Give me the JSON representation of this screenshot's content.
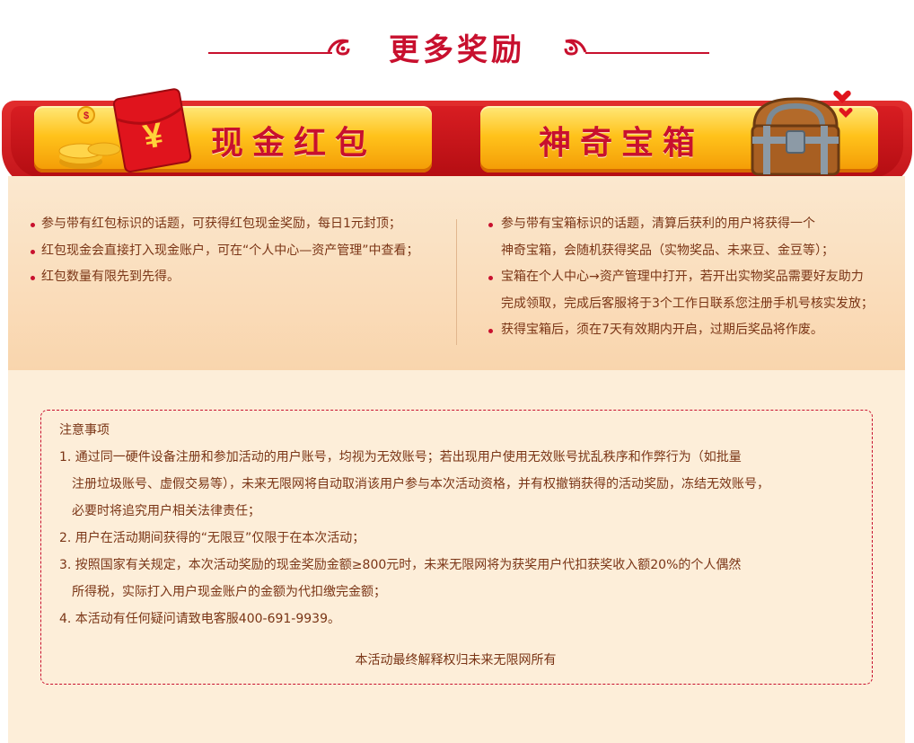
{
  "header": {
    "title": "更多奖励"
  },
  "tabs": {
    "cash_label": "现金红包",
    "chest_label": "神奇宝箱",
    "cash_icon": "red-packet-coins-icon",
    "cash_icon_glyph": "¥",
    "chest_icon": "treasure-chest-icon"
  },
  "cash_rules": [
    "参与带有红包标识的话题，可获得红包现金奖励，每日1元封顶；",
    "红包现金会直接打入现金账户，可在“个人中心—资产管理”中查看；",
    "红包数量有限先到先得。"
  ],
  "chest_rules": [
    {
      "line1": "参与带有宝箱标识的话题，清算后获利的用户将获得一个",
      "line2": "神奇宝箱，会随机获得奖品（实物奖品、未来豆、金豆等）；"
    },
    {
      "line1": "宝箱在个人中心→资产管理中打开，若开出实物奖品需要好友助力",
      "line2": "完成领取，完成后客服将于3个工作日联系您注册手机号核实发放；"
    },
    {
      "line1": "获得宝箱后，须在7天有效期内开启，过期后奖品将作废。",
      "line2": ""
    }
  ],
  "notice": {
    "title": "注意事项",
    "items": [
      {
        "line1": "1. 通过同一硬件设备注册和参加活动的用户账号，均视为无效账号；若出现用户使用无效账号扰乱秩序和作弊行为（如批量",
        "line2": "注册垃圾账号、虚假交易等），未来无限网将自动取消该用户参与本次活动资格，并有权撤销获得的活动奖励，冻结无效账号，",
        "line3": "必要时将追究用户相关法律责任；"
      },
      {
        "line1": "2. 用户在活动期间获得的“无限豆”仅限于在本次活动；",
        "line2": "",
        "line3": ""
      },
      {
        "line1": "3. 按照国家有关规定，本次活动奖励的现金奖励金额≥800元时，未来无限网将为获奖用户代扣获奖收入额20%的个人偶然",
        "line2": "所得税，实际打入用户现金账户的金额为代扣缴完金额；",
        "line3": ""
      },
      {
        "line1": "4. 本活动有任何疑问请致电客服400-691-9939。",
        "line2": "",
        "line3": ""
      }
    ],
    "footer": "本活动最终解释权归未来无限网所有"
  },
  "colors": {
    "accent_red": "#c8102e",
    "text_brown": "#7a3516",
    "gold": "#ffc21b"
  }
}
